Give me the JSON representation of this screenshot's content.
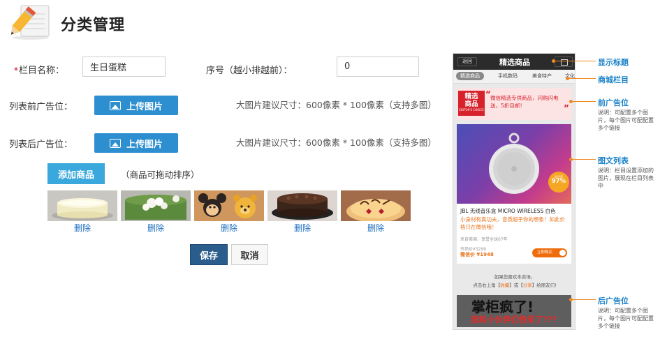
{
  "header": {
    "title": "分类管理",
    "icon": "pencil-notepad-icon"
  },
  "form": {
    "name_label": "栏目名称：",
    "required_mark": "*",
    "name_value": "生日蛋糕",
    "order_label": "序号（越小排越前）：",
    "order_value": "0",
    "pre_ad_label": "列表前广告位：",
    "post_ad_label": "列表后广告位：",
    "upload_label": "上传图片",
    "size_hint": "大图片建议尺寸：600像素 * 100像素（支持多图）",
    "add_product_label": "添加商品",
    "sortable_hint": "（商品可拖动排序）",
    "delete_label": "删除",
    "save_label": "保存",
    "cancel_label": "取消"
  },
  "products": [
    {
      "image": "cream-cake-photo"
    },
    {
      "image": "matcha-cake-photo"
    },
    {
      "image": "mickey-pooh-cake-photo"
    },
    {
      "image": "chocolate-cake-photo"
    },
    {
      "image": "birthday-lettering-cake-photo"
    }
  ],
  "preview": {
    "back_label": "返回",
    "title": "精选商品",
    "tabs": [
      "精选商品",
      "手机数码",
      "美食特产",
      "文化"
    ],
    "ad_badge_line1": "精选",
    "ad_badge_line2": "商品",
    "ad_badge_sub": "EDITOR'S CHOICE",
    "ad_text": "微信精选专供商品，闪购闪电送，5折包邮！",
    "score_label": "好评率",
    "score_value": "97%",
    "product_title": "JBL 无线音乐盒 MICRO WIRELESS 白色",
    "product_desc": "小身材有真功夫，音质超乎你的想象！如此价格只在微信哦！",
    "origin": "来自美国，享誉全球67年",
    "market_price": "市场价¥3299",
    "wechat_price": "微信价 ¥1948",
    "buy_label": "立即购买",
    "footer_line1": "如果您喜欢本卖场，",
    "footer_line2_a": "点击右上角【",
    "footer_line2_b": "收藏",
    "footer_line2_c": "】或【",
    "footer_line2_d": "分享",
    "footer_line2_e": "】给朋友们!",
    "bottom_ad_line1": "掌柜疯了!",
    "bottom_ad_line2": "我和小伙伴们惊呆了???"
  },
  "annotations": {
    "show_title": "显示标题",
    "mall_column": "商城栏目",
    "pre_ad": "前广告位",
    "pre_ad_desc": "说明：可配置多个图片，每个图片可配配置多个链接",
    "list": "图文列表",
    "list_desc": "说明：栏目设置添加的图片，展现在栏目列表中",
    "post_ad": "后广告位",
    "post_ad_desc": "说明：可配置多个图片，每个图片可配配置多个链接"
  },
  "colors": {
    "primary_blue": "#2d8fd0",
    "add_button": "#3aa8dd",
    "save_button": "#2a5c8c",
    "annotation_line": "#f08a24",
    "annotation_text": "#1a82c8",
    "delete_link": "#1f6fbf"
  }
}
